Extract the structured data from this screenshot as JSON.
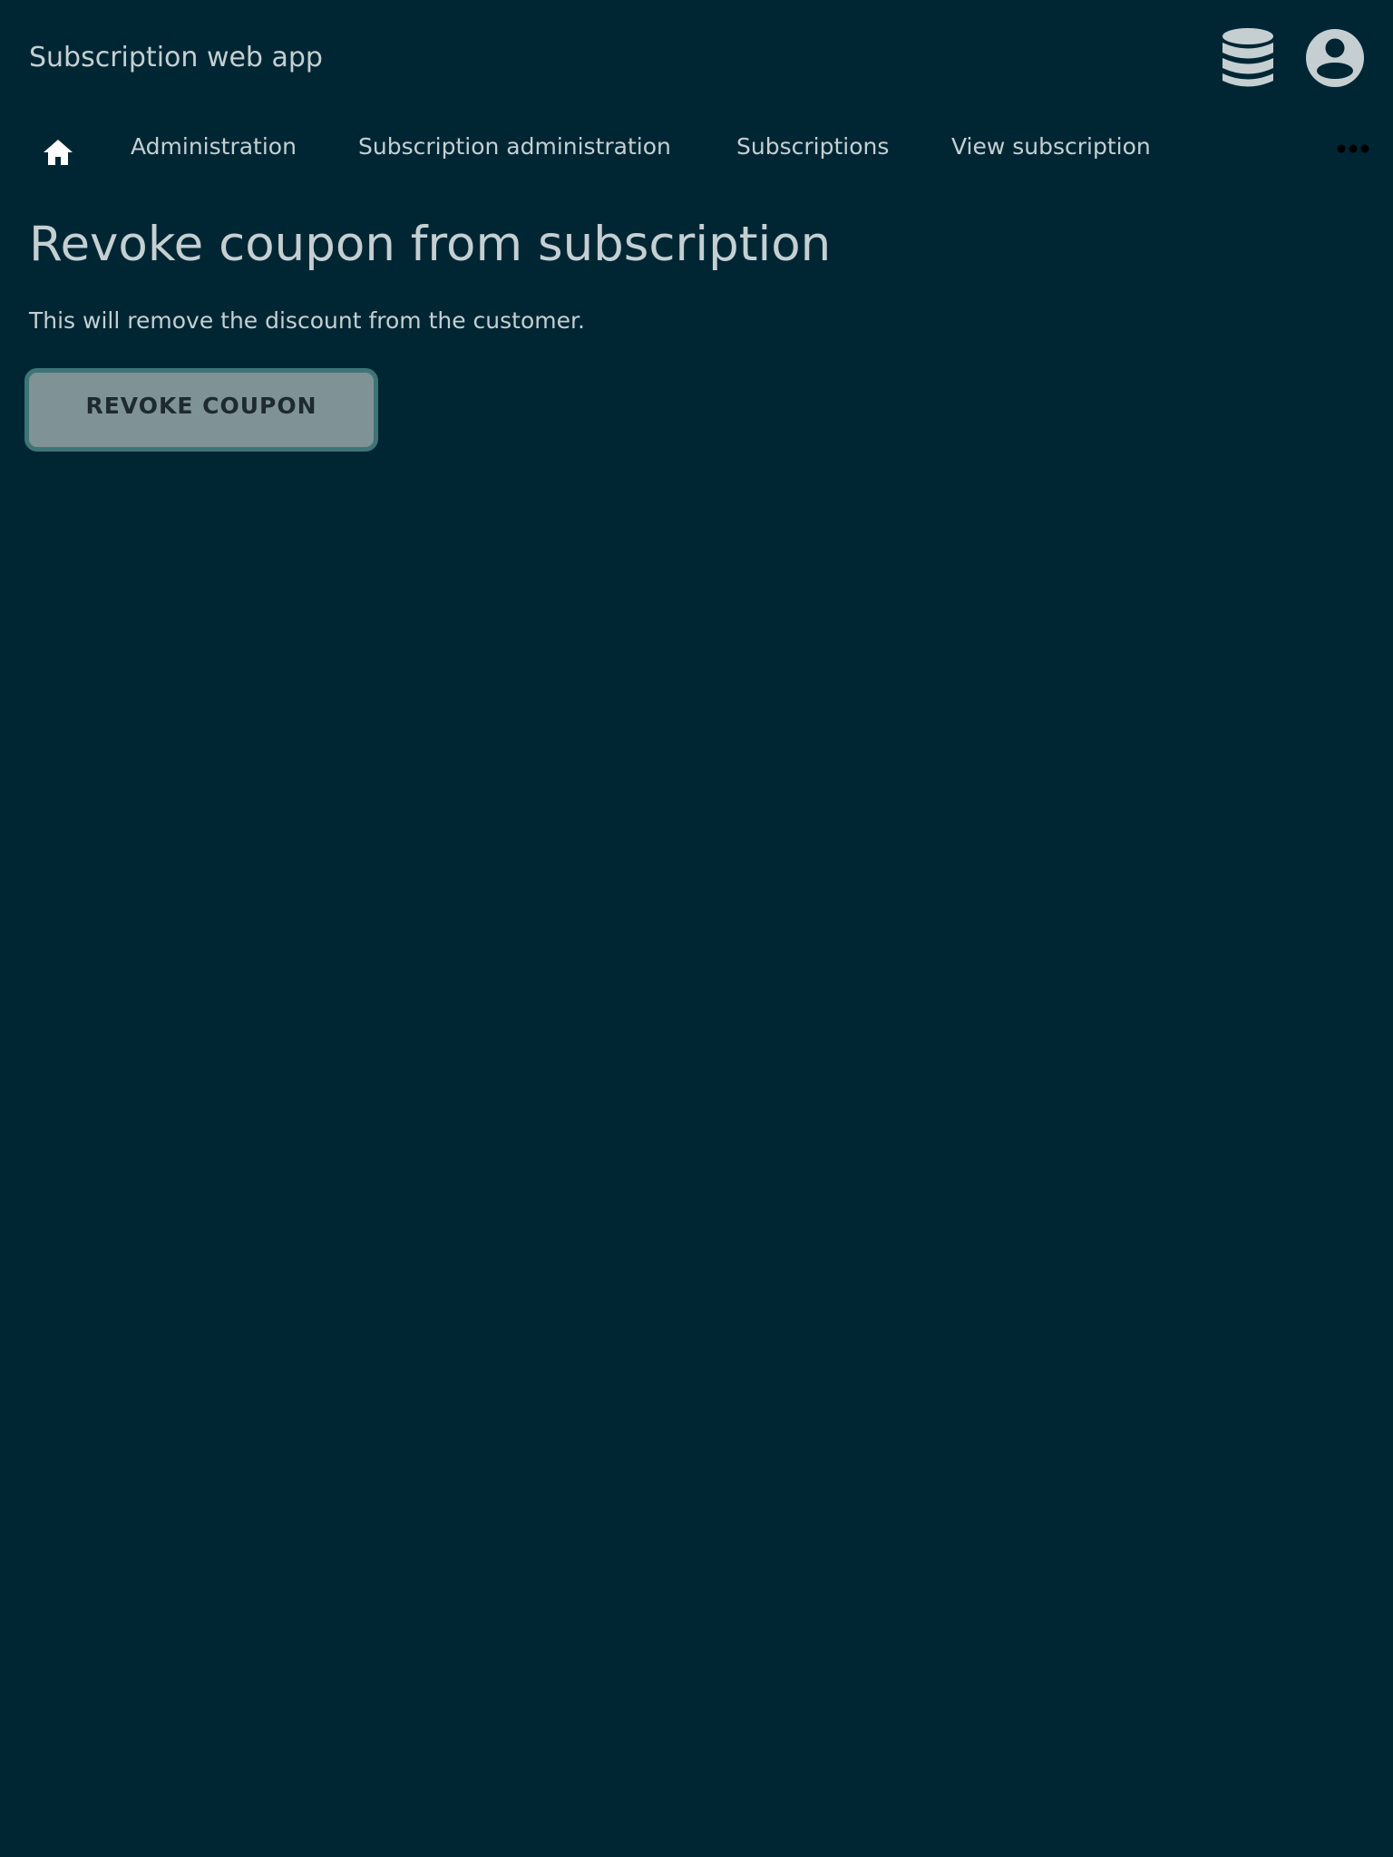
{
  "header": {
    "app_title": "Subscription web app",
    "icons": [
      "database-icon",
      "account-circle-icon"
    ]
  },
  "breadcrumbs": {
    "home_icon": "home-icon",
    "items": [
      {
        "label": "Administration"
      },
      {
        "label": "Subscription administration"
      },
      {
        "label": "Subscriptions"
      },
      {
        "label": "View subscription"
      }
    ],
    "more_icon": "more-horizontal-icon"
  },
  "main": {
    "title": "Revoke coupon from subscription",
    "description": "This will remove the discount from the customer.",
    "revoke_button_label": "REVOKE COUPON"
  },
  "colors": {
    "background": "#002634",
    "text": "#c5cfd2",
    "button_fill": "#7f9396",
    "button_border": "#3f7476",
    "button_text": "#1e2a2e"
  }
}
